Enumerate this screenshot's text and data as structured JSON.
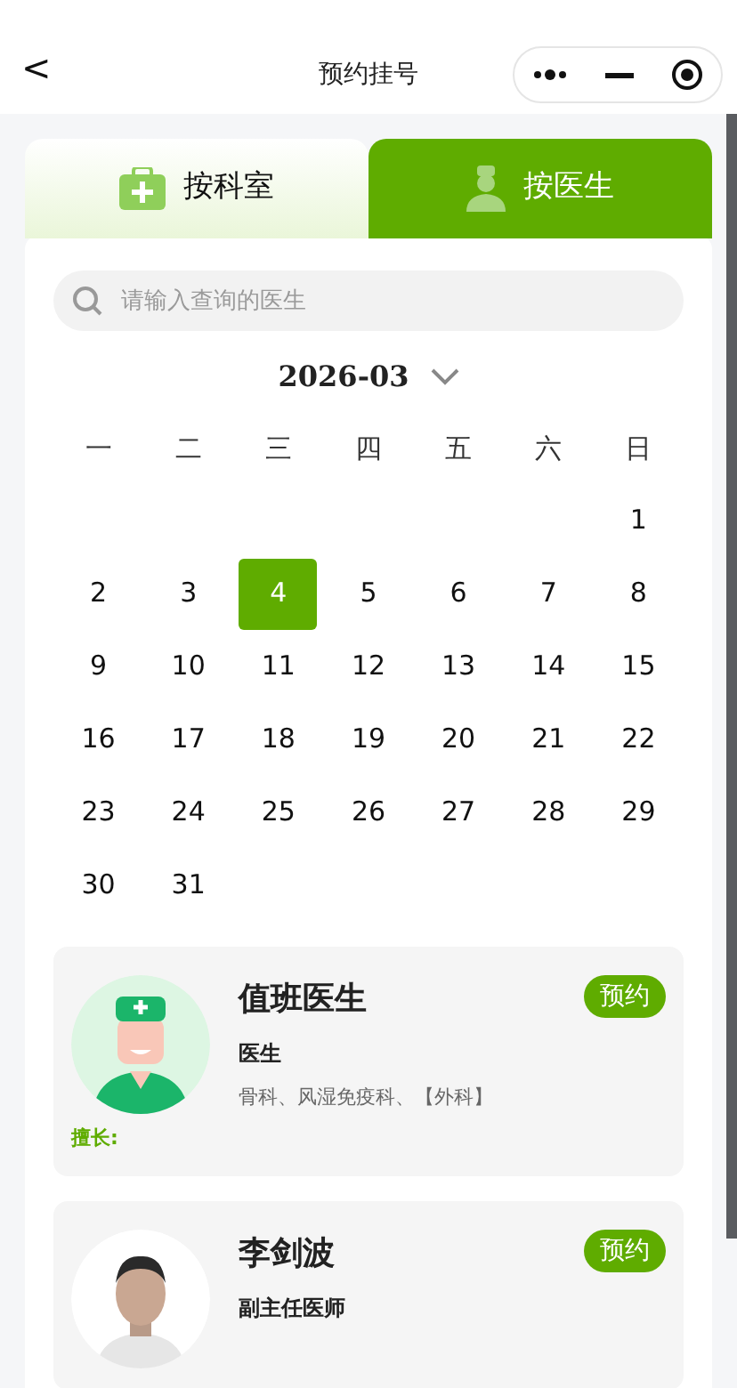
{
  "header": {
    "back": "<",
    "title": "预约挂号"
  },
  "tabs": [
    {
      "label": "按科室",
      "kind": "department",
      "selected": false
    },
    {
      "label": "按医生",
      "kind": "doctor",
      "selected": true
    }
  ],
  "search": {
    "placeholder": "请输入查询的医生"
  },
  "calendar": {
    "month": "2026-03",
    "weekdays": [
      "一",
      "二",
      "三",
      "四",
      "五",
      "六",
      "日"
    ],
    "weeks": [
      {
        "kind": "trailing",
        "days": [
          {
            "day": "1",
            "selected": false
          }
        ]
      },
      {
        "kind": "leading",
        "days": [
          {
            "day": "2",
            "selected": false
          },
          {
            "day": "3",
            "selected": false
          },
          {
            "day": "4",
            "selected": true
          },
          {
            "day": "5",
            "selected": false
          },
          {
            "day": "6",
            "selected": false
          },
          {
            "day": "7",
            "selected": false
          },
          {
            "day": "8",
            "selected": false
          }
        ]
      },
      {
        "kind": "leading",
        "days": [
          {
            "day": "9",
            "selected": false
          },
          {
            "day": "10",
            "selected": false
          },
          {
            "day": "11",
            "selected": false
          },
          {
            "day": "12",
            "selected": false
          },
          {
            "day": "13",
            "selected": false
          },
          {
            "day": "14",
            "selected": false
          },
          {
            "day": "15",
            "selected": false
          }
        ]
      },
      {
        "kind": "leading",
        "days": [
          {
            "day": "16",
            "selected": false
          },
          {
            "day": "17",
            "selected": false
          },
          {
            "day": "18",
            "selected": false
          },
          {
            "day": "19",
            "selected": false
          },
          {
            "day": "20",
            "selected": false
          },
          {
            "day": "21",
            "selected": false
          },
          {
            "day": "22",
            "selected": false
          }
        ]
      },
      {
        "kind": "leading",
        "days": [
          {
            "day": "23",
            "selected": false
          },
          {
            "day": "24",
            "selected": false
          },
          {
            "day": "25",
            "selected": false
          },
          {
            "day": "26",
            "selected": false
          },
          {
            "day": "27",
            "selected": false
          },
          {
            "day": "28",
            "selected": false
          },
          {
            "day": "29",
            "selected": false
          }
        ]
      },
      {
        "kind": "leading",
        "days": [
          {
            "day": "30",
            "selected": false
          },
          {
            "day": "31",
            "selected": false
          }
        ]
      }
    ]
  },
  "doctors": [
    {
      "name": "值班医生",
      "kind": "illustration",
      "title": "医生",
      "departments": "骨科、风湿免疫科、【外科】",
      "specialty": "擅长:",
      "button": "预约"
    },
    {
      "name": "李剑波",
      "kind": "picture",
      "title": "副主任医师",
      "button": "预约"
    }
  ]
}
